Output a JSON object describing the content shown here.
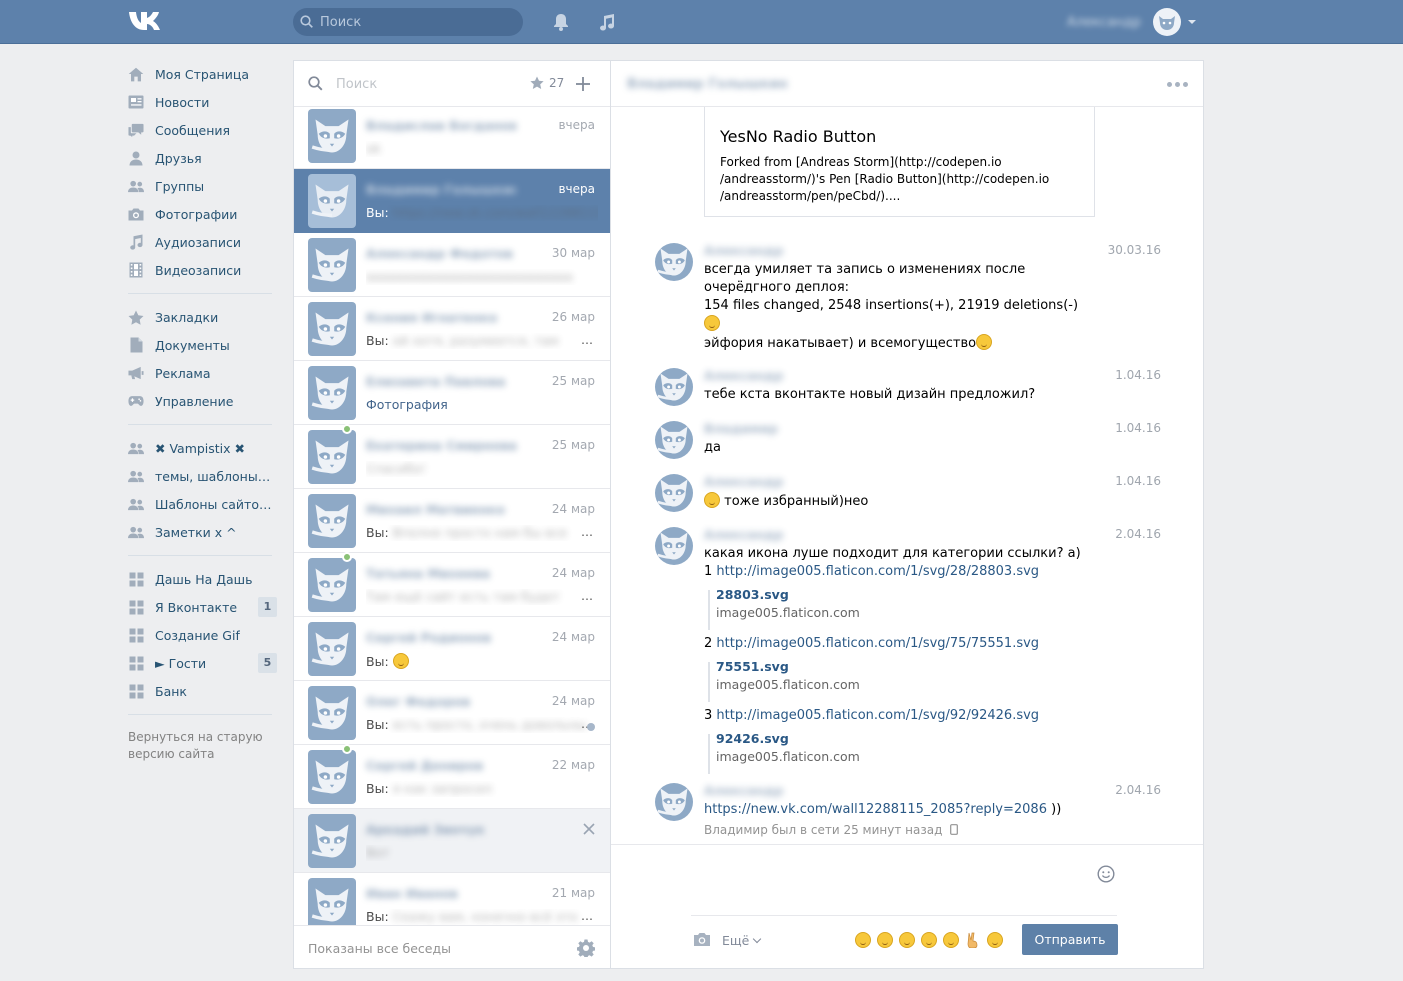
{
  "header": {
    "logo": "VK",
    "search_placeholder": "Поиск",
    "user_name": "Александр",
    "colors": {
      "bar": "#5d81ab",
      "accent": "#5e81a8"
    }
  },
  "nav": {
    "main": [
      {
        "label": "Моя Страница",
        "icon": "home-icon"
      },
      {
        "label": "Новости",
        "icon": "news-icon"
      },
      {
        "label": "Сообщения",
        "icon": "messages-icon"
      },
      {
        "label": "Друзья",
        "icon": "friend-icon"
      },
      {
        "label": "Группы",
        "icon": "groups-icon"
      },
      {
        "label": "Фотографии",
        "icon": "camera-icon"
      },
      {
        "label": "Аудиозаписи",
        "icon": "music-icon"
      },
      {
        "label": "Видеозаписи",
        "icon": "film-icon"
      }
    ],
    "secondary": [
      {
        "label": "Закладки",
        "icon": "star-icon"
      },
      {
        "label": "Документы",
        "icon": "document-icon"
      },
      {
        "label": "Реклама",
        "icon": "megaphone-icon"
      },
      {
        "label": "Управление",
        "icon": "gamepad-icon"
      }
    ],
    "groups": [
      {
        "label": "✖ Vampistix ✖",
        "icon": "groups-icon"
      },
      {
        "label": "темы, шаблоны и...",
        "icon": "groups-icon"
      },
      {
        "label": "Шаблоны сайтов,...",
        "icon": "groups-icon"
      },
      {
        "label": "Заметки x ^",
        "icon": "groups-icon"
      }
    ],
    "apps": [
      {
        "label": "Дашь На Дашь",
        "count": ""
      },
      {
        "label": "Я Вконтакте",
        "count": "1"
      },
      {
        "label": "Создание Gif",
        "count": ""
      },
      {
        "label": "► Гости",
        "count": "5"
      },
      {
        "label": "Банк",
        "count": ""
      }
    ],
    "footer": "Вернуться на старую версию сайта"
  },
  "dialogs": {
    "search_placeholder": "Поиск",
    "starred_count": "27",
    "footer": "Показаны все беседы",
    "items": [
      {
        "name": "Владислав Богданов",
        "date": "вчера",
        "prefix": "",
        "text": "ok",
        "blur": true,
        "online": false,
        "selected": false
      },
      {
        "name": "Владимир Голышкин",
        "date": "вчера",
        "prefix": "Вы:",
        "text": "https://new.vk.com/wall12288115",
        "blur": true,
        "online": false,
        "selected": true
      },
      {
        "name": "Александр Федотов",
        "date": "30 мар",
        "prefix": "",
        "text": "ааааааааааааааааааааааааааа",
        "blur": true,
        "online": false,
        "selected": false
      },
      {
        "name": "Ксения Игнатенко",
        "date": "26 мар",
        "prefix": "Вы:",
        "text": "ой хотя, разумеется, там",
        "blur": true,
        "online": false,
        "selected": false,
        "ellipsis": true
      },
      {
        "name": "Елизавета Павлова",
        "date": "25 мар",
        "prefix": "",
        "text": "Фотография",
        "blur": false,
        "link": true,
        "online": false,
        "selected": false
      },
      {
        "name": "Екатерина Смирнова",
        "date": "25 мар",
        "prefix": "",
        "text": "Спасибо!",
        "blur": true,
        "online": true,
        "selected": false
      },
      {
        "name": "Михаил Матвиенко",
        "date": "24 мар",
        "prefix": "Вы:",
        "text": "Вполне просто нам бы все",
        "blur": true,
        "online": false,
        "selected": false,
        "ellipsis": true
      },
      {
        "name": "Татьяна Михеева",
        "date": "24 мар",
        "prefix": "",
        "text": "Там ещё сайт есть там будет",
        "blur": true,
        "online": true,
        "selected": false,
        "ellipsis": true
      },
      {
        "name": "Сергей Родионов",
        "date": "24 мар",
        "prefix": "Вы:",
        "text": "",
        "emoji": true,
        "blur": false,
        "online": false,
        "selected": false
      },
      {
        "name": "Олег Федоров",
        "date": "24 мар",
        "prefix": "Вы:",
        "text": "есть просто, очень довольны",
        "blur": true,
        "online": false,
        "selected": false,
        "ellipsis": true,
        "unread": true
      },
      {
        "name": "Сергей Дениров",
        "date": "22 мар",
        "prefix": "Вы:",
        "text": "я как запросил",
        "blur": true,
        "online": true,
        "selected": false
      },
      {
        "name": "Аркадий Зинчук",
        "date": "",
        "prefix": "",
        "text": "Вот",
        "blur": true,
        "online": false,
        "selected": false,
        "hover": true
      },
      {
        "name": "Иван Иванов",
        "date": "21 мар",
        "prefix": "Вы:",
        "text": "Скажу вам, конечно всё это",
        "blur": true,
        "online": false,
        "selected": false,
        "ellipsis": true
      }
    ]
  },
  "chat": {
    "title": "Владимир Голышкин",
    "snippet": {
      "title": "YesNo Radio Button",
      "desc": "Forked from [Andreas Storm](http://codepen.io /andreasstorm/)'s Pen [Radio Button](http://codepen.io /andreasstorm/pen/peCbd/)...."
    },
    "messages": [
      {
        "author": "Александр",
        "time": "30.03.16",
        "lines": [
          "всегда умиляет та запись о изменениях после",
          "очерёдгного деплоя:",
          "154 files changed, 2548 insertions(+), 21919 deletions(-)"
        ],
        "tail": "эйфория накатывает) и всемогущество"
      },
      {
        "author": "Александр",
        "time": "1.04.16",
        "text": "тебе кста вконтакте новый дизайн предложил?"
      },
      {
        "author": "Владимир",
        "time": "1.04.16",
        "text": "да"
      },
      {
        "author": "Александр",
        "time": "1.04.16",
        "text": "тоже избранный)нео"
      },
      {
        "author": "Александр",
        "time": "2.04.16",
        "text": "какая икона луше подходит для категории ссылки? а)",
        "links": [
          {
            "num": "1",
            "url": "http://image005.flaticon.com/1/svg/28/28803.svg",
            "file": "28803.svg",
            "site": "image005.flaticon.com"
          },
          {
            "num": "2",
            "url": "http://image005.flaticon.com/1/svg/75/75551.svg",
            "file": "75551.svg",
            "site": "image005.flaticon.com"
          },
          {
            "num": "3",
            "url": "http://image005.flaticon.com/1/svg/92/92426.svg",
            "file": "92426.svg",
            "site": "image005.flaticon.com"
          }
        ]
      },
      {
        "author": "Александр",
        "time": "2.04.16",
        "link": "https://new.vk.com/wall12288115_2085?reply=2086",
        "link_tail": " ))"
      }
    ],
    "status": "Владимир был в сети 25 минут назад",
    "compose": {
      "more_label": "Ещё",
      "send_label": "Отправить"
    }
  }
}
